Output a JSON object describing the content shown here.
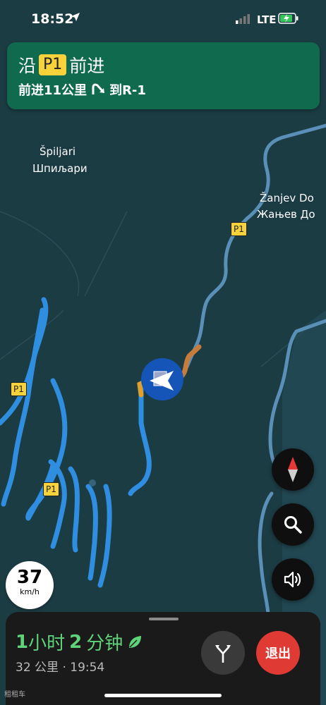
{
  "status_bar": {
    "time": "18:52",
    "network": "LTE"
  },
  "instruction": {
    "prefix": "沿",
    "road": "P1",
    "suffix": "前进",
    "distance_text": "前进11公里",
    "then_text": "到R-1"
  },
  "map": {
    "places": [
      {
        "name_latin": "Špiljari",
        "name_cyrillic": "Шпиљари"
      },
      {
        "name_latin": "Žanjev Do",
        "name_cyrillic": "Жањев До"
      }
    ],
    "road_shields": [
      "P1",
      "P1",
      "P1"
    ],
    "colors": {
      "background": "#1c3c44",
      "route": "#2f8ee0",
      "traffic": "#c67c3c",
      "roads": "#5a8fb8"
    }
  },
  "speed": {
    "value": "37",
    "unit": "km/h"
  },
  "trip": {
    "eta_hours": "1",
    "eta_hours_unit": "小时",
    "eta_minutes": "2",
    "eta_minutes_unit": "分钟",
    "distance_time": "32 公里 · 19:54",
    "exit_label": "退出"
  },
  "watermark": "租租车",
  "icons": [
    "location-arrow-icon",
    "signal-icon",
    "battery-charging-icon",
    "turn-right-icon",
    "compass-icon",
    "search-icon",
    "volume-icon",
    "leaf-icon",
    "alternate-routes-icon",
    "navigation-arrow-icon"
  ]
}
